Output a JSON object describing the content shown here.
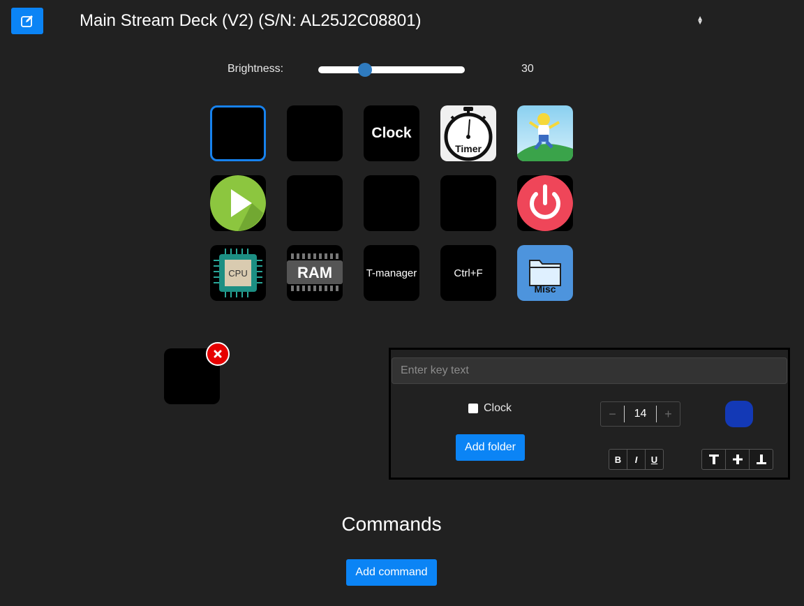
{
  "header": {
    "edit_icon": "edit-square-icon",
    "device_label": "Main Stream Deck (V2) (S/N: AL25J2C08801)",
    "select_icon": "sort-arrows-icon"
  },
  "brightness": {
    "label": "Brightness:",
    "value": "30",
    "slider_fraction": 0.3
  },
  "keys": [
    {
      "label": "",
      "selected": true
    },
    {
      "label": ""
    },
    {
      "label": "Clock"
    },
    {
      "label": "Timer",
      "icon": "stopwatch-icon"
    },
    {
      "icon": "homer-simpson-image"
    },
    {
      "icon": "play-icon"
    },
    {
      "label": ""
    },
    {
      "label": ""
    },
    {
      "label": ""
    },
    {
      "icon": "power-icon"
    },
    {
      "label": "CPU",
      "icon": "cpu-chip-icon"
    },
    {
      "label": "RAM",
      "icon": "ram-module-icon"
    },
    {
      "label": "T-manager"
    },
    {
      "label": "Ctrl+F"
    },
    {
      "label": "Misc",
      "icon": "folder-icon"
    }
  ],
  "preview": {
    "delete_icon": "close-icon"
  },
  "editor": {
    "key_text_placeholder": "Enter key text",
    "key_text_value": "",
    "clock_label": "Clock",
    "clock_checked": false,
    "add_folder_label": "Add folder",
    "font_size": "14",
    "decrement_symbol": "−",
    "increment_symbol": "+",
    "text_color": "#1339b6",
    "style_buttons": [
      "B",
      "I",
      "U"
    ],
    "valign_icons": [
      "align-top-icon",
      "align-middle-icon",
      "align-bottom-icon"
    ]
  },
  "commands": {
    "title": "Commands",
    "add_command_label": "Add command"
  },
  "colors": {
    "accent": "#0b84f5",
    "background": "#212121",
    "delete": "#e60000"
  }
}
